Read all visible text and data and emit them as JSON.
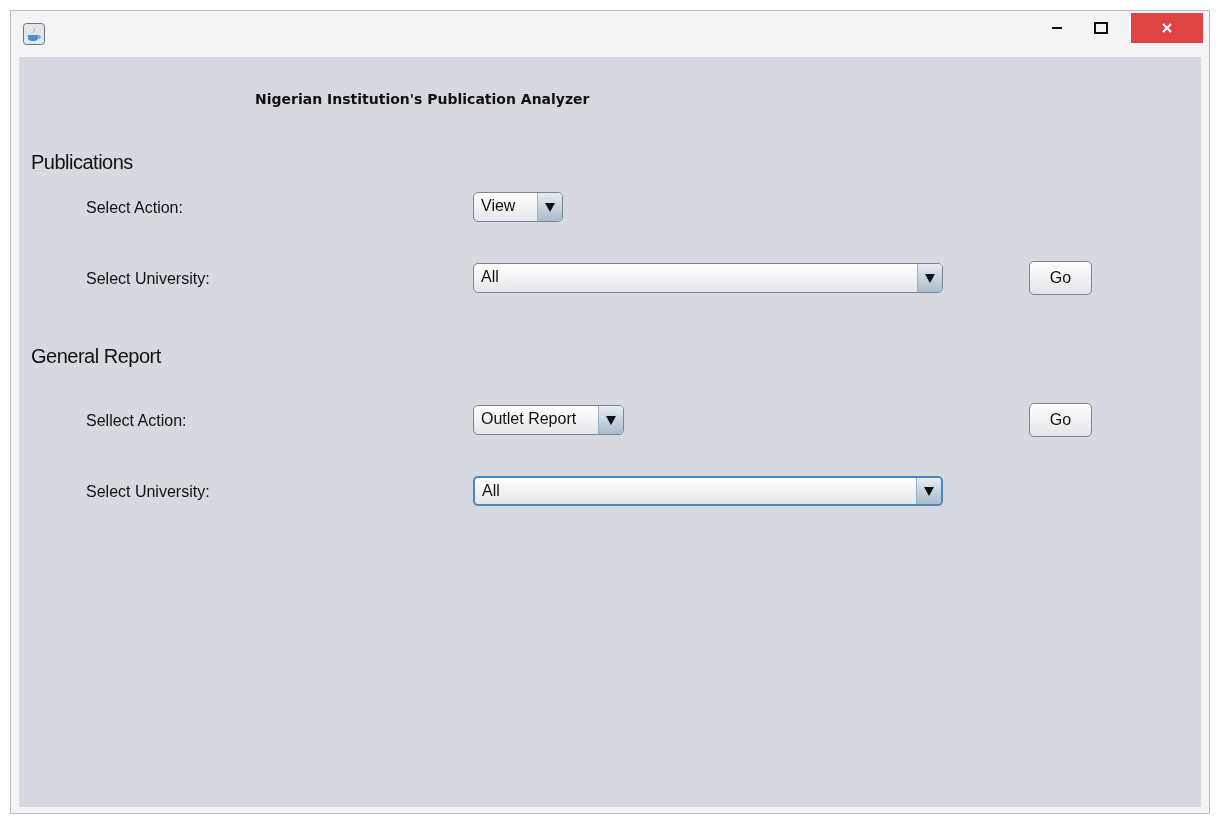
{
  "app_title": "Nigerian Institution's Publication Analyzer",
  "sections": [
    {
      "heading": "Publications",
      "rows": [
        {
          "label": "Select Action:",
          "combo": {
            "kind": "compact",
            "value": "View",
            "focused": false
          },
          "go_button": null
        },
        {
          "label": "Select University:",
          "combo": {
            "kind": "wide",
            "value": "All",
            "focused": false
          },
          "go_button": "Go"
        }
      ]
    },
    {
      "heading": "General Report",
      "rows": [
        {
          "label": "Sellect Action:",
          "combo": {
            "kind": "compact",
            "value": "Outlet Report",
            "focused": false
          },
          "go_button": "Go"
        },
        {
          "label": "Select University:",
          "combo": {
            "kind": "wide",
            "value": "All",
            "focused": true
          },
          "go_button": null
        }
      ]
    }
  ]
}
